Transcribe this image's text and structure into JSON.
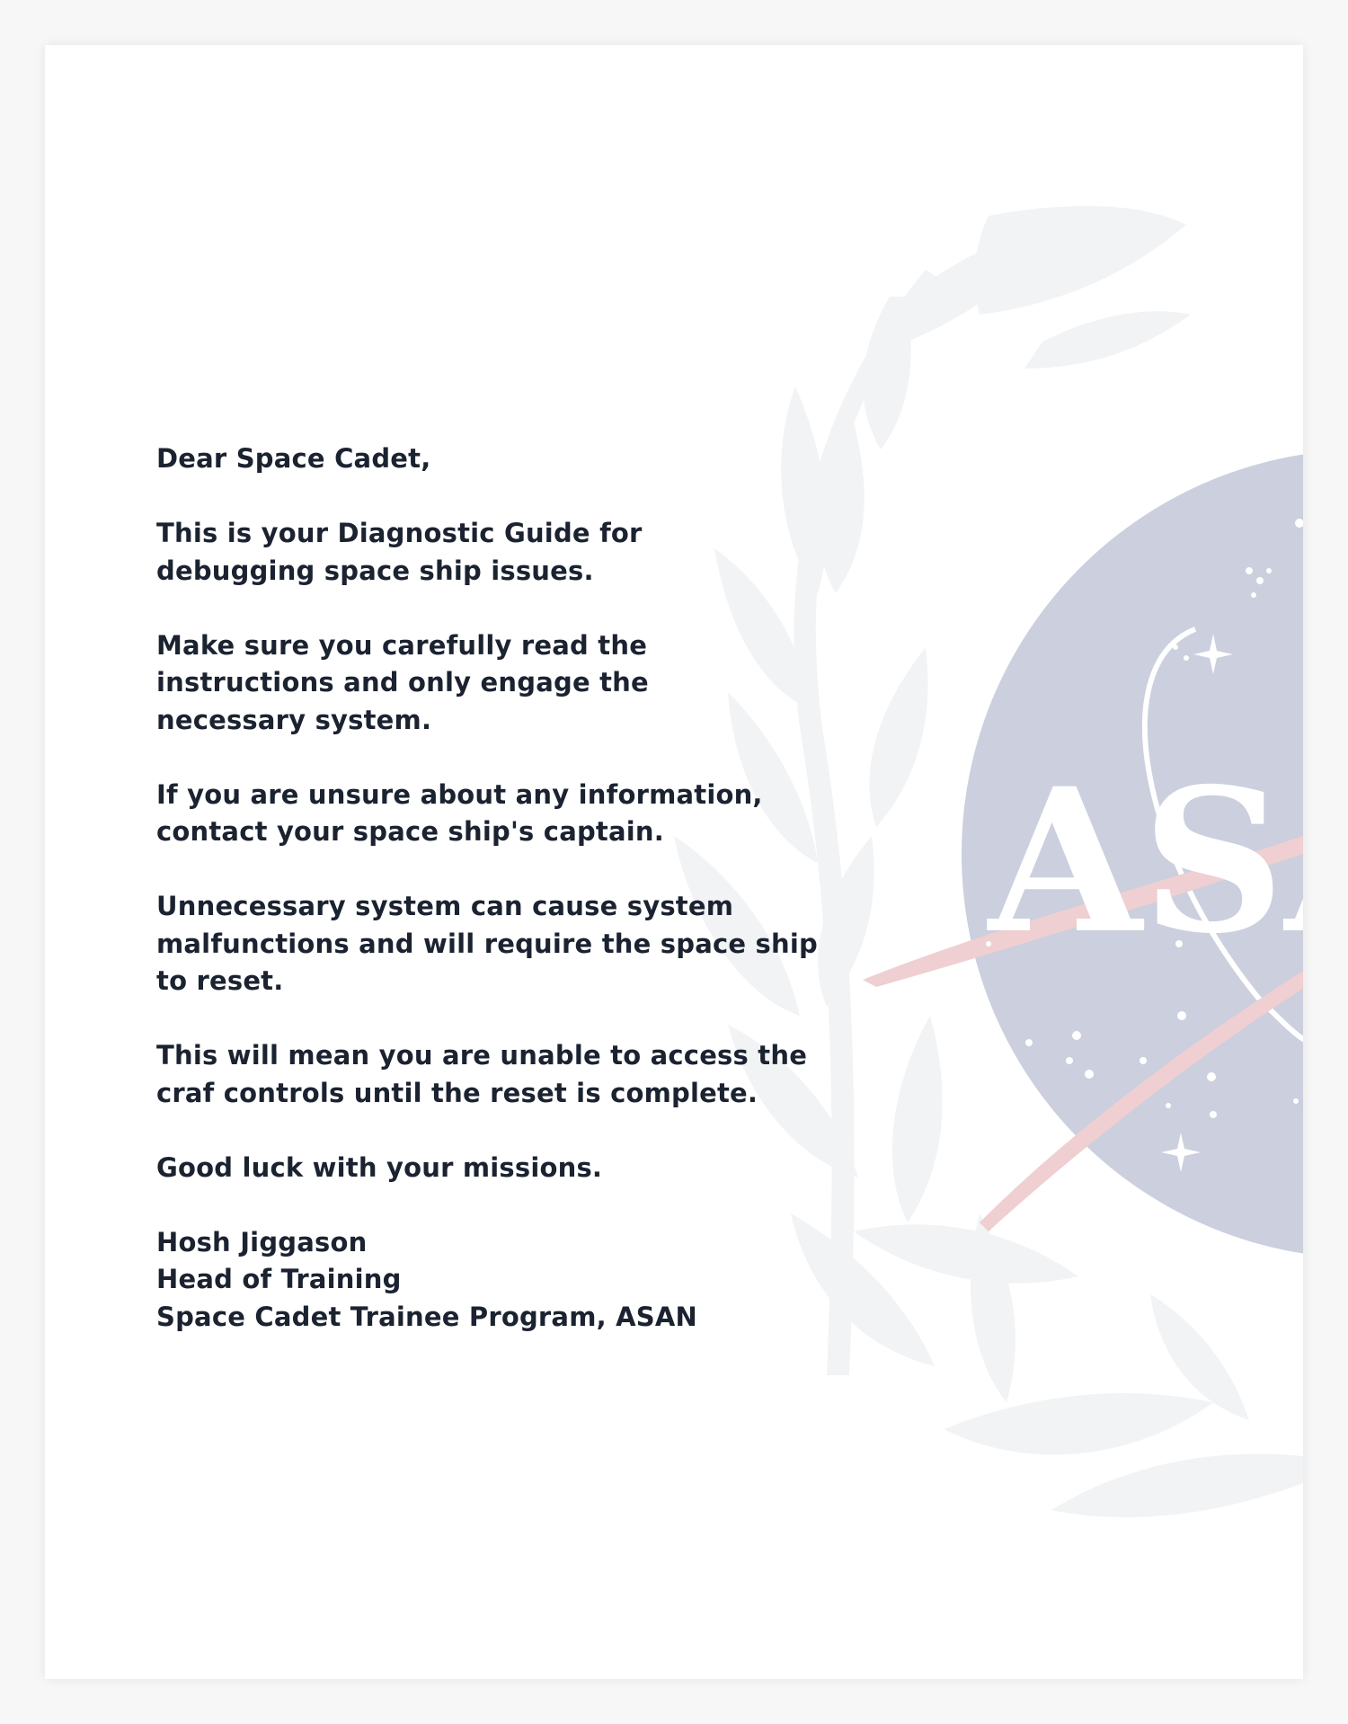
{
  "letter": {
    "salutation": "Dear Space Cadet,",
    "paragraphs": [
      "This is your Diagnostic Guide for\ndebugging space ship issues.",
      "Make sure you carefully read the\ninstructions and only engage the\nnecessary system.",
      "If you are unsure about any information,\ncontact your space ship's captain.",
      "Unnecessary system can cause system\nmalfunctions and will require the space ship\nto reset.",
      "This will mean you are unable to access the\ncraf controls until the reset is complete.",
      "Good luck with your missions."
    ],
    "signature": {
      "name": "Hosh Jiggason",
      "role": "Head of Training",
      "organization": "Space Cadet Trainee Program, ASAN"
    }
  },
  "watermark": {
    "text": "ASAN",
    "colors": {
      "globe": "#cbcfde",
      "laurel": "#f2f3f5",
      "swoosh": "#efcfd1",
      "stars": "#ffffff"
    }
  },
  "colors": {
    "text": "#1b2230",
    "page": "#ffffff"
  }
}
